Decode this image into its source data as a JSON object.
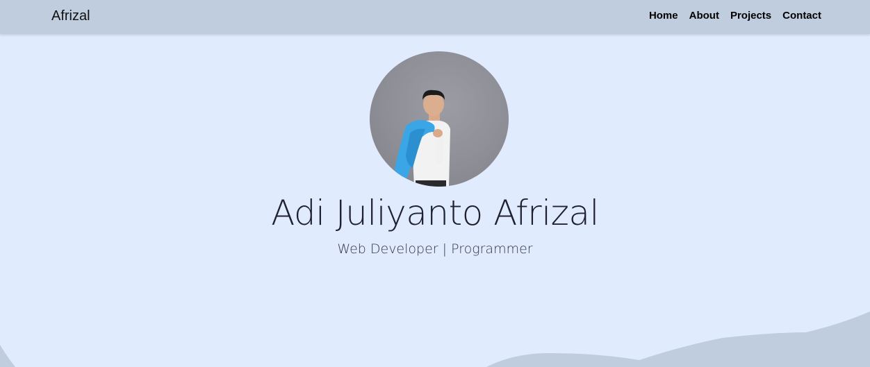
{
  "navbar": {
    "brand": "Afrizal",
    "links": [
      {
        "label": "Home"
      },
      {
        "label": "About"
      },
      {
        "label": "Projects"
      },
      {
        "label": "Contact"
      }
    ]
  },
  "hero": {
    "name": "Adi Juliyanto Afrizal",
    "subtitle": "Web Developer | Programmer"
  },
  "colors": {
    "background": "#e0ecfe",
    "navbar": "#bfcddf",
    "wave": "#bfcddf",
    "text": "#1f2130",
    "accent_jacket": "#3aa6e6"
  }
}
